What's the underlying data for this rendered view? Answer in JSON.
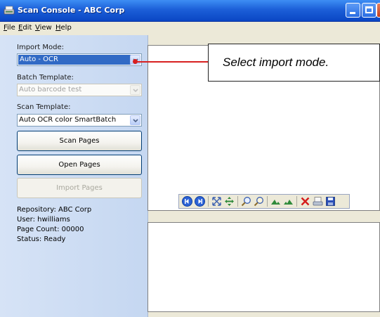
{
  "window": {
    "title": "Scan Console - ABC Corp"
  },
  "menu": [
    {
      "mnemonic": "F",
      "rest": "ile"
    },
    {
      "mnemonic": "E",
      "rest": "dit"
    },
    {
      "mnemonic": "V",
      "rest": "iew"
    },
    {
      "mnemonic": "H",
      "rest": "elp"
    }
  ],
  "left": {
    "import_mode_label": "Import Mode:",
    "import_mode_value": "Auto - OCR",
    "batch_template_label": "Batch Template:",
    "batch_template_value": "Auto barcode test",
    "scan_template_label": "Scan Template:",
    "scan_template_value": "Auto OCR color SmartBatch",
    "scan_button": "Scan Pages",
    "open_button": "Open Pages",
    "import_button": "Import Pages"
  },
  "info": {
    "repository": "Repository: ABC Corp",
    "user": "User: hwilliams",
    "page_count": "Page Count: 00000",
    "status": "Status: Ready"
  },
  "callout": {
    "text": "Select import mode."
  },
  "toolbar_icons": [
    "first-page-icon",
    "next-page-icon",
    "fit-icon",
    "pan-icon",
    "zoom-in-icon",
    "zoom-out-icon",
    "rotate-left-icon",
    "rotate-right-icon",
    "delete-icon",
    "scan-icon",
    "save-icon"
  ],
  "colors": {
    "title_bar": "#0a46c4",
    "selection": "#316ac5",
    "callout_line": "#d82020",
    "panel": "#c5d7f1"
  }
}
